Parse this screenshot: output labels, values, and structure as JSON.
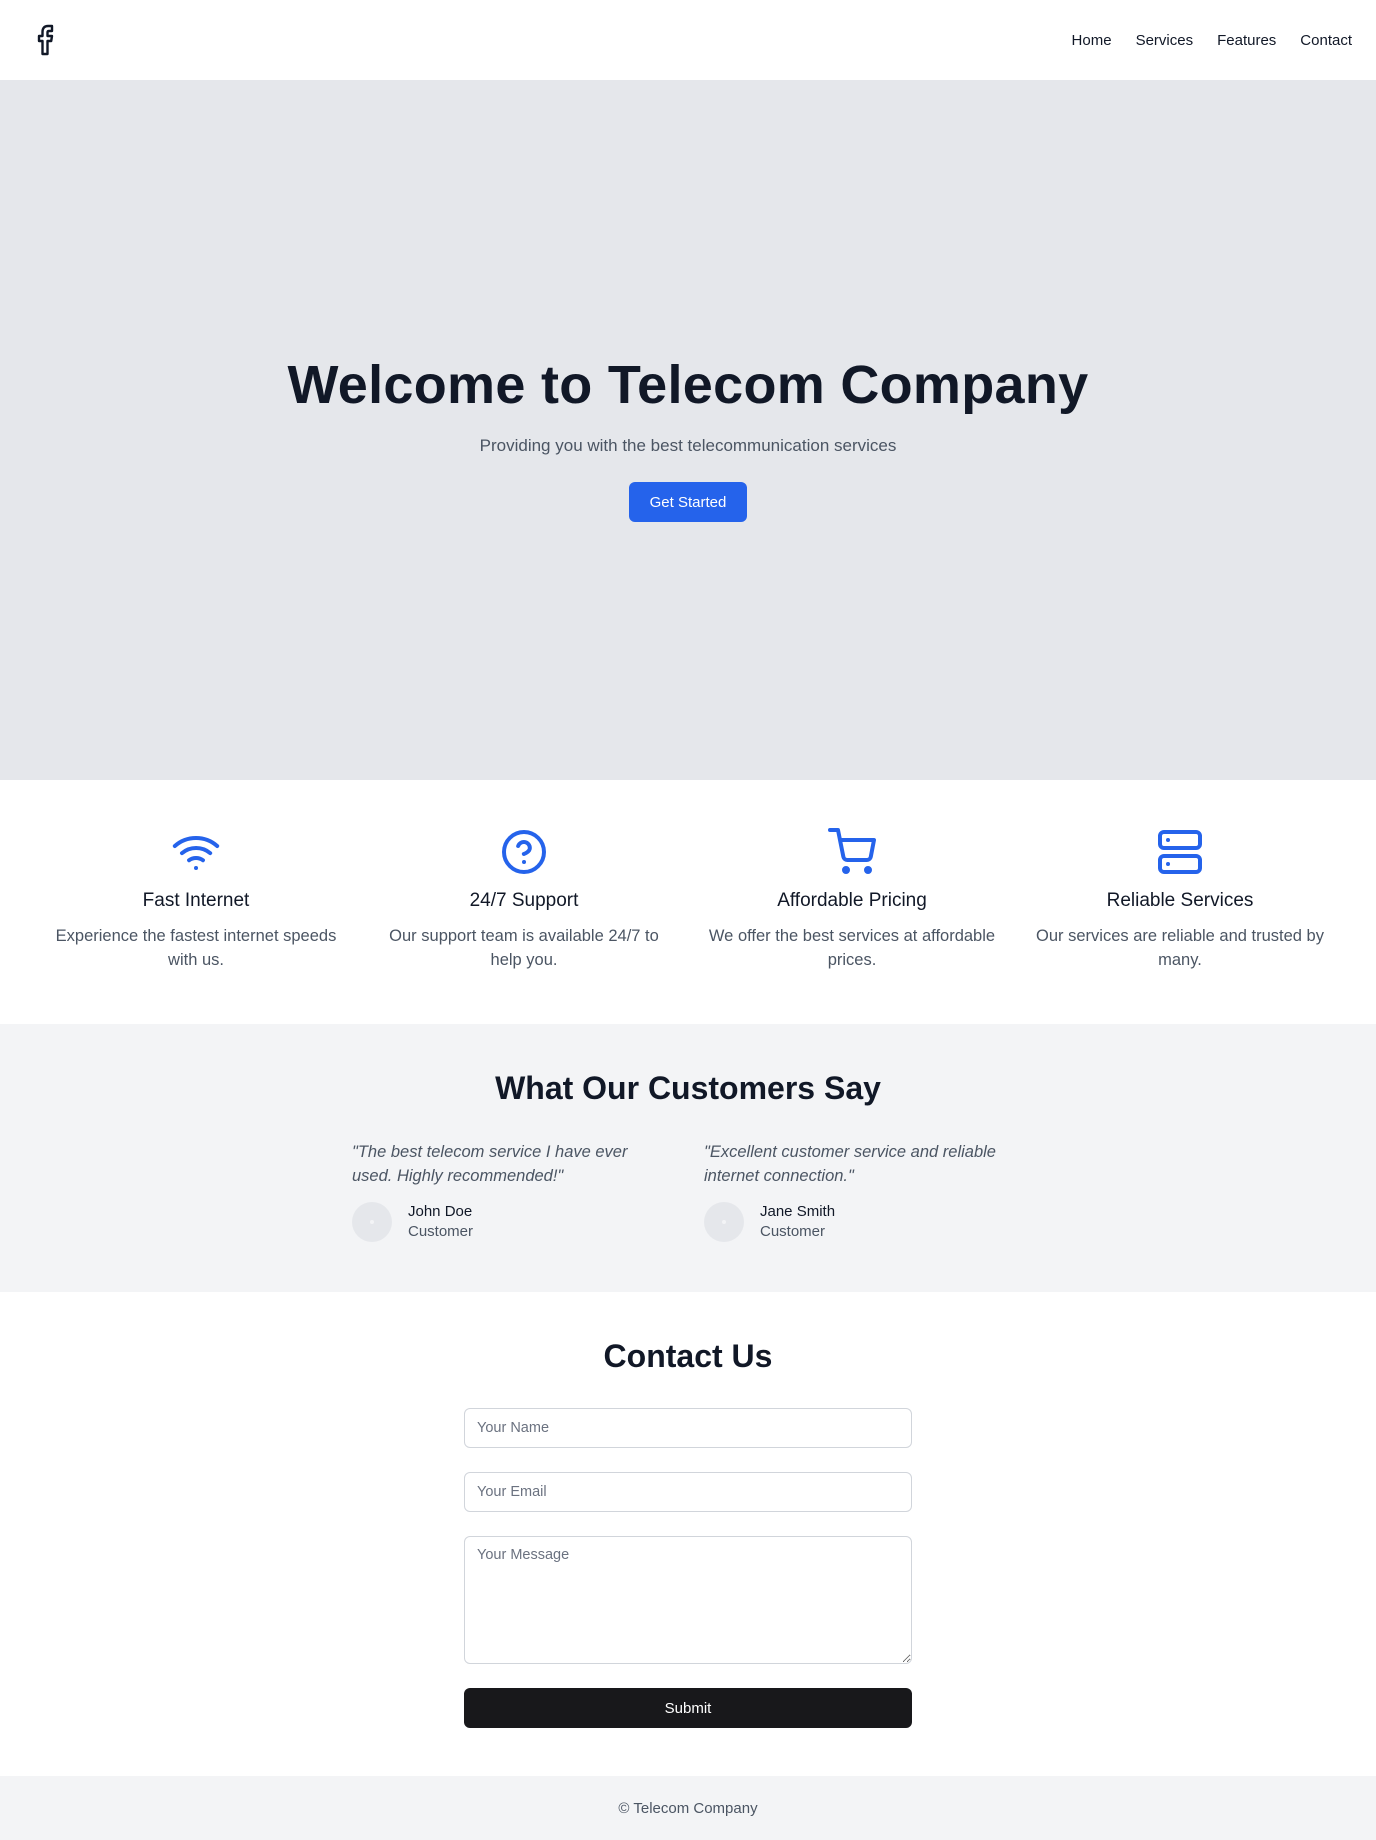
{
  "header": {
    "logo_icon": "facebook-icon",
    "nav": [
      {
        "label": "Home"
      },
      {
        "label": "Services"
      },
      {
        "label": "Features"
      },
      {
        "label": "Contact"
      }
    ]
  },
  "hero": {
    "title": "Welcome to Telecom Company",
    "subtitle": "Providing you with the best telecommunication services",
    "cta_label": "Get Started"
  },
  "features": [
    {
      "icon": "wifi-icon",
      "title": "Fast Internet",
      "text": "Experience the fastest internet speeds with us."
    },
    {
      "icon": "help-circle-icon",
      "title": "24/7 Support",
      "text": "Our support team is available 24/7 to help you."
    },
    {
      "icon": "shopping-cart-icon",
      "title": "Affordable Pricing",
      "text": "We offer the best services at affordable prices."
    },
    {
      "icon": "server-icon",
      "title": "Reliable Services",
      "text": "Our services are reliable and trusted by many."
    }
  ],
  "testimonials": {
    "heading": "What Our Customers Say",
    "items": [
      {
        "quote": "\"The best telecom service I have ever used. Highly recommended!\"",
        "name": "John Doe",
        "role": "Customer"
      },
      {
        "quote": "\"Excellent customer service and reliable internet connection.\"",
        "name": "Jane Smith",
        "role": "Customer"
      }
    ]
  },
  "contact": {
    "heading": "Contact Us",
    "name_placeholder": "Your Name",
    "email_placeholder": "Your Email",
    "message_placeholder": "Your Message",
    "submit_label": "Submit"
  },
  "footer": {
    "text": "© Telecom Company"
  },
  "colors": {
    "accent": "#2563eb",
    "hero_bg": "#e5e7eb",
    "section_bg": "#f3f4f6",
    "submit_bg": "#18181b"
  }
}
